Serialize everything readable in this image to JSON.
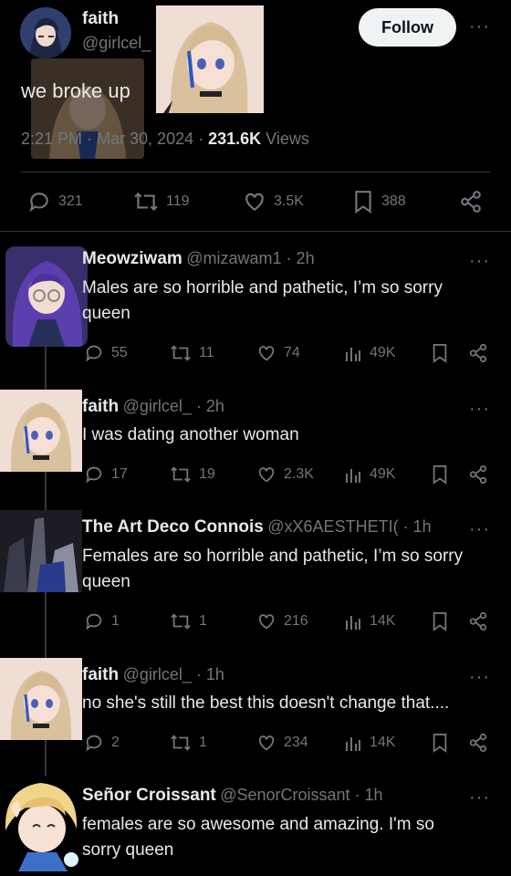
{
  "main_tweet": {
    "display_name": "faith",
    "handle": "@girlcel_",
    "text": "we broke up",
    "time": "2:21 PM · Mar 30, 2024 ·",
    "views_count": "231.6K",
    "views_label": "Views",
    "follow_label": "Follow",
    "stats": {
      "replies": "321",
      "retweets": "119",
      "likes": "3.5K",
      "bookmarks": "388"
    }
  },
  "replies": [
    {
      "name": "Meowziwam",
      "handle": "@mizawam1 · 2h",
      "text": "Males are so horrible and pathetic, I’m so sorry queen",
      "replies": "55",
      "retweets": "11",
      "likes": "74",
      "views": "49K"
    },
    {
      "name": "faith",
      "handle": "@girlcel_ · 2h",
      "text": "I was dating another woman",
      "replies": "17",
      "retweets": "19",
      "likes": "2.3K",
      "views": "49K"
    },
    {
      "name": "The Art Deco Connois",
      "handle": "@xX6AESTHETI( · 1h",
      "text": "Females are so horrible and pathetic, I’m so sorry queen",
      "replies": "1",
      "retweets": "1",
      "likes": "216",
      "views": "14K"
    },
    {
      "name": "faith",
      "handle": "@girlcel_ · 1h",
      "text": "no she's still the best this doesn't change that....",
      "replies": "2",
      "retweets": "1",
      "likes": "234",
      "views": "14K"
    },
    {
      "name": "Señor Croissant",
      "handle": "@SenorCroissant · 1h",
      "text": "females are so awesome and amazing. I'm so sorry queen"
    }
  ],
  "colors": {
    "background": "#000000",
    "text": "#e7e9ea",
    "muted": "#71767b",
    "follow_bg": "#eff3f4"
  }
}
